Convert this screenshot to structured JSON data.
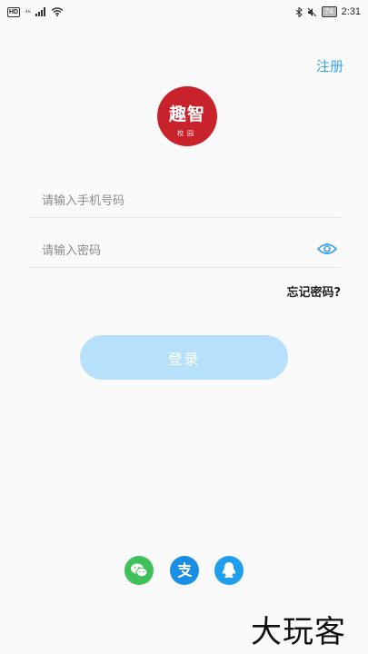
{
  "status_bar": {
    "hd": "HD",
    "network": "⁴⁶",
    "battery": "74",
    "time": "2:31"
  },
  "header": {
    "register_label": "注册"
  },
  "logo": {
    "main_text": "趣智",
    "sub_text": "校园"
  },
  "form": {
    "phone_placeholder": "请输入手机号码",
    "password_placeholder": "请输入密码",
    "forgot_label": "忘记密码?",
    "login_label": "登录"
  },
  "third_party_login": [
    "wechat",
    "alipay",
    "qq"
  ],
  "watermark": "大玩客",
  "colors": {
    "accent": "#3aa2e8",
    "login_button": "#b7e1fa",
    "logo": "#c8222a",
    "wechat": "#3fc05b",
    "alipay": "#1a8ee4",
    "qq": "#1e9eed"
  }
}
